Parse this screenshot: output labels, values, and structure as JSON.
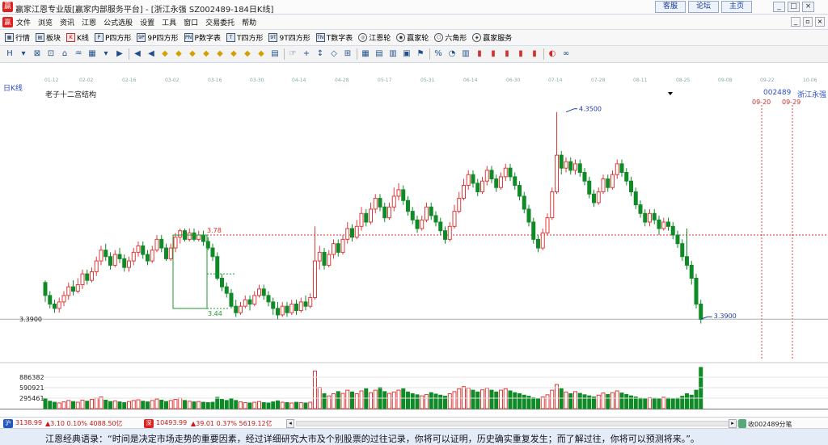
{
  "window": {
    "title": "赢家江恩专业版[赢家内部服务平台] - [浙江永强   SZ002489-184日K线]",
    "site_links": [
      "客服",
      "论坛",
      "主页"
    ]
  },
  "menu": [
    "文件",
    "浏览",
    "资讯",
    "江恩",
    "公式选股",
    "设置",
    "工具",
    "窗口",
    "交易委托",
    "帮助"
  ],
  "toolbar": [
    {
      "label": "行情",
      "icon": "quote-grid-icon"
    },
    {
      "label": "板块",
      "icon": "sector-icon"
    },
    {
      "label": "K线",
      "icon": "kline-icon"
    },
    {
      "label": "P四方形",
      "icon": "p-square-icon"
    },
    {
      "label": "9P四方形",
      "icon": "9p-square-icon"
    },
    {
      "label": "P数字表",
      "icon": "p-number-table-icon"
    },
    {
      "label": "T四方形",
      "icon": "t-square-icon"
    },
    {
      "label": "9T四方形",
      "icon": "9t-square-icon"
    },
    {
      "label": "T数字表",
      "icon": "t-number-table-icon"
    },
    {
      "label": "江恩轮",
      "icon": "gann-wheel-icon"
    },
    {
      "label": "赢家轮",
      "icon": "winner-wheel-icon"
    },
    {
      "label": "六角形",
      "icon": "hexagon-icon"
    },
    {
      "label": "赢家服务",
      "icon": "service-icon"
    }
  ],
  "chart_header": {
    "period": "日K线",
    "name": "老子十二宫结构",
    "code": "002489",
    "stock": "浙江永强"
  },
  "date_axis": [
    "01-12",
    "02-02",
    "02-16",
    "03-02",
    "03-16",
    "03-30",
    "04-14",
    "04-28",
    "05-17",
    "05-31",
    "06-14",
    "06-30",
    "07-14",
    "07-28",
    "08-11",
    "08-25",
    "09-08",
    "09-22",
    "10-06"
  ],
  "chart_data": {
    "type": "candlestick",
    "title": "",
    "xlabel": "",
    "ylabel": "",
    "series": [],
    "annotations": {
      "high_marker": "4.3500",
      "low_marker": "3.3900",
      "box_top": "3.78",
      "box_bottom": "3.44",
      "future_date_1": "09-20",
      "future_date_2": "09-29"
    },
    "price_axis": {
      "current": "3.3900",
      "ylim": [
        3.2,
        4.42
      ]
    },
    "volume_axis": {
      "ticks": [
        "886382",
        "590921",
        "295461"
      ],
      "max": 1181843
    },
    "candles": [
      [
        3.56,
        3.5,
        3.57,
        3.47
      ],
      [
        3.5,
        3.46,
        3.52,
        3.44
      ],
      [
        3.46,
        3.44,
        3.48,
        3.42
      ],
      [
        3.44,
        3.47,
        3.49,
        3.42
      ],
      [
        3.47,
        3.5,
        3.52,
        3.45
      ],
      [
        3.5,
        3.54,
        3.56,
        3.48
      ],
      [
        3.54,
        3.52,
        3.57,
        3.5
      ],
      [
        3.52,
        3.55,
        3.58,
        3.51
      ],
      [
        3.55,
        3.6,
        3.62,
        3.53
      ],
      [
        3.6,
        3.57,
        3.62,
        3.55
      ],
      [
        3.57,
        3.61,
        3.63,
        3.56
      ],
      [
        3.61,
        3.66,
        3.68,
        3.59
      ],
      [
        3.66,
        3.71,
        3.73,
        3.64
      ],
      [
        3.71,
        3.68,
        3.74,
        3.66
      ],
      [
        3.68,
        3.64,
        3.7,
        3.62
      ],
      [
        3.64,
        3.69,
        3.71,
        3.63
      ],
      [
        3.69,
        3.67,
        3.72,
        3.65
      ],
      [
        3.67,
        3.63,
        3.69,
        3.61
      ],
      [
        3.63,
        3.66,
        3.68,
        3.61
      ],
      [
        3.66,
        3.7,
        3.72,
        3.64
      ],
      [
        3.7,
        3.73,
        3.75,
        3.68
      ],
      [
        3.73,
        3.69,
        3.75,
        3.67
      ],
      [
        3.69,
        3.66,
        3.71,
        3.64
      ],
      [
        3.66,
        3.71,
        3.73,
        3.65
      ],
      [
        3.71,
        3.76,
        3.78,
        3.7
      ],
      [
        3.76,
        3.72,
        3.78,
        3.7
      ],
      [
        3.72,
        3.67,
        3.74,
        3.66
      ],
      [
        3.67,
        3.72,
        3.74,
        3.66
      ],
      [
        3.72,
        3.77,
        3.79,
        3.7
      ],
      [
        3.77,
        3.8,
        3.81,
        3.74
      ],
      [
        3.8,
        3.76,
        3.81,
        3.75
      ],
      [
        3.76,
        3.79,
        3.81,
        3.75
      ],
      [
        3.79,
        3.76,
        3.81,
        3.75
      ],
      [
        3.76,
        3.78,
        3.8,
        3.75
      ],
      [
        3.78,
        3.75,
        3.8,
        3.73
      ],
      [
        3.75,
        3.72,
        3.77,
        3.71
      ],
      [
        3.72,
        3.68,
        3.74,
        3.66
      ],
      [
        3.68,
        3.58,
        3.7,
        3.57
      ],
      [
        3.58,
        3.54,
        3.6,
        3.52
      ],
      [
        3.54,
        3.51,
        3.56,
        3.49
      ],
      [
        3.51,
        3.45,
        3.53,
        3.44
      ],
      [
        3.45,
        3.42,
        3.48,
        3.4
      ],
      [
        3.42,
        3.45,
        3.47,
        3.41
      ],
      [
        3.45,
        3.48,
        3.5,
        3.44
      ],
      [
        3.48,
        3.46,
        3.5,
        3.43
      ],
      [
        3.46,
        3.5,
        3.52,
        3.45
      ],
      [
        3.5,
        3.53,
        3.55,
        3.49
      ],
      [
        3.53,
        3.5,
        3.55,
        3.48
      ],
      [
        3.5,
        3.47,
        3.52,
        3.45
      ],
      [
        3.47,
        3.44,
        3.49,
        3.41
      ],
      [
        3.44,
        3.41,
        3.47,
        3.39
      ],
      [
        3.41,
        3.45,
        3.47,
        3.4
      ],
      [
        3.45,
        3.42,
        3.47,
        3.4
      ],
      [
        3.42,
        3.46,
        3.48,
        3.41
      ],
      [
        3.46,
        3.43,
        3.48,
        3.41
      ],
      [
        3.43,
        3.47,
        3.49,
        3.42
      ],
      [
        3.47,
        3.45,
        3.5,
        3.43
      ],
      [
        3.45,
        3.49,
        3.51,
        3.44
      ],
      [
        3.49,
        3.66,
        3.82,
        3.48
      ],
      [
        3.66,
        3.7,
        3.73,
        3.62
      ],
      [
        3.7,
        3.64,
        3.72,
        3.62
      ],
      [
        3.64,
        3.69,
        3.71,
        3.63
      ],
      [
        3.69,
        3.74,
        3.76,
        3.67
      ],
      [
        3.74,
        3.7,
        3.76,
        3.68
      ],
      [
        3.7,
        3.76,
        3.78,
        3.69
      ],
      [
        3.76,
        3.81,
        3.84,
        3.74
      ],
      [
        3.81,
        3.77,
        3.83,
        3.75
      ],
      [
        3.77,
        3.82,
        3.85,
        3.76
      ],
      [
        3.82,
        3.88,
        3.91,
        3.8
      ],
      [
        3.88,
        3.84,
        3.9,
        3.82
      ],
      [
        3.84,
        3.9,
        3.93,
        3.83
      ],
      [
        3.9,
        3.95,
        3.97,
        3.88
      ],
      [
        3.95,
        3.91,
        3.97,
        3.89
      ],
      [
        3.91,
        3.86,
        3.93,
        3.84
      ],
      [
        3.86,
        3.91,
        3.93,
        3.85
      ],
      [
        3.91,
        3.96,
        4.0,
        3.89
      ],
      [
        3.96,
        3.99,
        4.02,
        3.94
      ],
      [
        3.99,
        3.94,
        4.01,
        3.92
      ],
      [
        3.94,
        3.89,
        3.96,
        3.87
      ],
      [
        3.89,
        3.85,
        3.91,
        3.83
      ],
      [
        3.85,
        3.81,
        3.87,
        3.79
      ],
      [
        3.81,
        3.85,
        3.87,
        3.8
      ],
      [
        3.85,
        3.91,
        3.93,
        3.84
      ],
      [
        3.91,
        3.87,
        3.93,
        3.85
      ],
      [
        3.87,
        3.84,
        3.89,
        3.82
      ],
      [
        3.84,
        3.8,
        3.86,
        3.78
      ],
      [
        3.8,
        3.76,
        3.82,
        3.74
      ],
      [
        3.76,
        3.82,
        3.84,
        3.75
      ],
      [
        3.82,
        3.89,
        3.92,
        3.81
      ],
      [
        3.89,
        3.95,
        3.98,
        3.88
      ],
      [
        3.95,
        4.01,
        4.04,
        3.94
      ],
      [
        4.01,
        4.06,
        4.08,
        3.99
      ],
      [
        4.06,
        4.02,
        4.08,
        4.0
      ],
      [
        4.02,
        3.98,
        4.04,
        3.96
      ],
      [
        3.98,
        4.03,
        4.05,
        3.97
      ],
      [
        4.03,
        4.08,
        4.1,
        4.01
      ],
      [
        4.08,
        4.04,
        4.1,
        4.02
      ],
      [
        4.04,
        4.0,
        4.06,
        3.98
      ],
      [
        4.0,
        4.05,
        4.07,
        3.99
      ],
      [
        4.05,
        4.09,
        4.11,
        4.03
      ],
      [
        4.09,
        4.05,
        4.11,
        4.03
      ],
      [
        4.05,
        4.01,
        4.07,
        3.99
      ],
      [
        4.01,
        3.96,
        4.03,
        3.94
      ],
      [
        3.96,
        3.9,
        3.98,
        3.88
      ],
      [
        3.9,
        3.84,
        3.92,
        3.82
      ],
      [
        3.84,
        3.76,
        3.86,
        3.74
      ],
      [
        3.76,
        3.72,
        3.78,
        3.7
      ],
      [
        3.72,
        3.79,
        3.81,
        3.71
      ],
      [
        3.79,
        3.86,
        3.88,
        3.78
      ],
      [
        3.86,
        3.98,
        4.0,
        3.85
      ],
      [
        3.98,
        4.15,
        4.35,
        3.97
      ],
      [
        4.15,
        4.09,
        4.17,
        4.06
      ],
      [
        4.09,
        4.12,
        4.14,
        4.07
      ],
      [
        4.12,
        4.08,
        4.14,
        4.06
      ],
      [
        4.08,
        4.11,
        4.13,
        4.06
      ],
      [
        4.11,
        4.07,
        4.13,
        4.05
      ],
      [
        4.07,
        4.03,
        4.09,
        4.01
      ],
      [
        4.03,
        3.97,
        4.05,
        3.95
      ],
      [
        3.97,
        3.93,
        3.99,
        3.91
      ],
      [
        3.93,
        3.98,
        4.0,
        3.92
      ],
      [
        3.98,
        4.04,
        4.06,
        3.97
      ],
      [
        4.04,
        4.0,
        4.06,
        3.98
      ],
      [
        4.0,
        4.06,
        4.08,
        3.99
      ],
      [
        4.06,
        4.11,
        4.13,
        4.04
      ],
      [
        4.11,
        4.07,
        4.13,
        4.05
      ],
      [
        4.07,
        4.03,
        4.09,
        4.01
      ],
      [
        4.03,
        3.98,
        4.05,
        3.96
      ],
      [
        3.98,
        3.92,
        4.0,
        3.9
      ],
      [
        3.92,
        3.88,
        3.94,
        3.86
      ],
      [
        3.88,
        3.84,
        3.9,
        3.82
      ],
      [
        3.84,
        3.88,
        3.9,
        3.82
      ],
      [
        3.88,
        3.85,
        3.9,
        3.83
      ],
      [
        3.85,
        3.81,
        3.87,
        3.78
      ],
      [
        3.81,
        3.84,
        3.86,
        3.8
      ],
      [
        3.84,
        3.82,
        3.86,
        3.8
      ],
      [
        3.82,
        3.78,
        3.84,
        3.76
      ],
      [
        3.78,
        3.74,
        3.8,
        3.72
      ],
      [
        3.74,
        3.68,
        3.76,
        3.66
      ],
      [
        3.68,
        3.64,
        3.81,
        3.62
      ],
      [
        3.64,
        3.58,
        3.66,
        3.55
      ],
      [
        3.58,
        3.46,
        3.6,
        3.44
      ],
      [
        3.46,
        3.39,
        3.48,
        3.37
      ]
    ],
    "volumes": [
      295,
      210,
      180,
      160,
      190,
      230,
      200,
      180,
      240,
      210,
      260,
      300,
      330,
      240,
      200,
      220,
      190,
      170,
      200,
      230,
      250,
      210,
      190,
      230,
      270,
      240,
      200,
      230,
      260,
      300,
      230,
      210,
      190,
      200,
      180,
      170,
      180,
      320,
      260,
      230,
      280,
      230,
      190,
      170,
      160,
      180,
      200,
      170,
      160,
      190,
      220,
      180,
      170,
      160,
      180,
      170,
      160,
      180,
      1060,
      600,
      420,
      360,
      420,
      480,
      430,
      520,
      470,
      420,
      500,
      560,
      450,
      520,
      600,
      480,
      430,
      470,
      520,
      560,
      470,
      420,
      390,
      360,
      400,
      450,
      410,
      380,
      350,
      420,
      480,
      560,
      620,
      580,
      520,
      470,
      530,
      580,
      520,
      470,
      520,
      560,
      500,
      450,
      420,
      380,
      350,
      310,
      290,
      330,
      390,
      520,
      680,
      560,
      470,
      420,
      480,
      430,
      390,
      360,
      330,
      380,
      440,
      400,
      450,
      500,
      440,
      400,
      360,
      330,
      300,
      290,
      310,
      300,
      280,
      320,
      300,
      290,
      300,
      350,
      420,
      380,
      520,
      1160
    ]
  },
  "ticker": {
    "sh_index": "3138.99",
    "sh_change": "▲3.10 0.10% 4088.50亿",
    "sz_index": "10493.99",
    "sz_change": "▲39.01 0.37% 5619.12亿",
    "right_text": "收002489分笔"
  },
  "quote": "江恩经典语录：“时间是决定市场走势的重要因素，经过详细研究大市及个别股票的过往记录，你将可以证明，历史确实重复发生；而了解过往，你将可以预测将来。”。",
  "colors": {
    "up": "#e03a3a",
    "down": "#0e8a26",
    "box": "#1f9a2a",
    "ref_line": "#e02a2a",
    "future_line": "#e04040"
  }
}
